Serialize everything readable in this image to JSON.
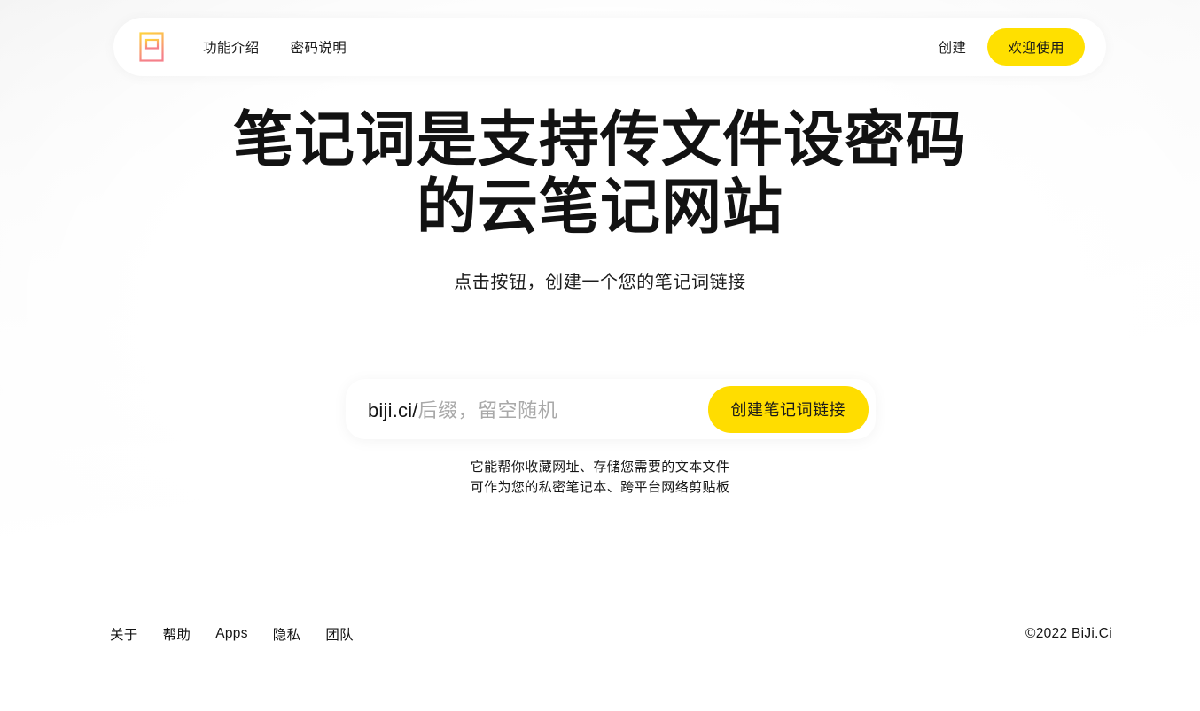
{
  "site": {
    "logo_icon": "notebook-icon",
    "logo_gradient_from": "#FFD23F",
    "logo_gradient_to": "#F5808A"
  },
  "header": {
    "nav_links": [
      {
        "label": "功能介绍"
      },
      {
        "label": "密码说明"
      }
    ],
    "create_link": "创建",
    "cta_label": "欢迎使用",
    "cta_color": "#FFE000"
  },
  "hero": {
    "headline_line1": "笔记词是支持传文件设密码",
    "headline_line2": "的云笔记网站",
    "subtitle": "点击按钮，创建一个您的笔记词链接"
  },
  "create_form": {
    "url_prefix": "biji.ci/",
    "input_placeholder": "后缀，留空随机",
    "input_value": "",
    "submit_label": "创建笔记词链接",
    "submit_color": "#FFDD00"
  },
  "description": {
    "line1": "它能帮你收藏网址、存储您需要的文本文件",
    "line2": "可作为您的私密笔记本、跨平台网络剪贴板"
  },
  "footer": {
    "links": [
      {
        "label": "关于"
      },
      {
        "label": "帮助"
      },
      {
        "label": "Apps"
      },
      {
        "label": "隐私"
      },
      {
        "label": "团队"
      }
    ],
    "copyright": "©2022 BiJi.Ci"
  }
}
